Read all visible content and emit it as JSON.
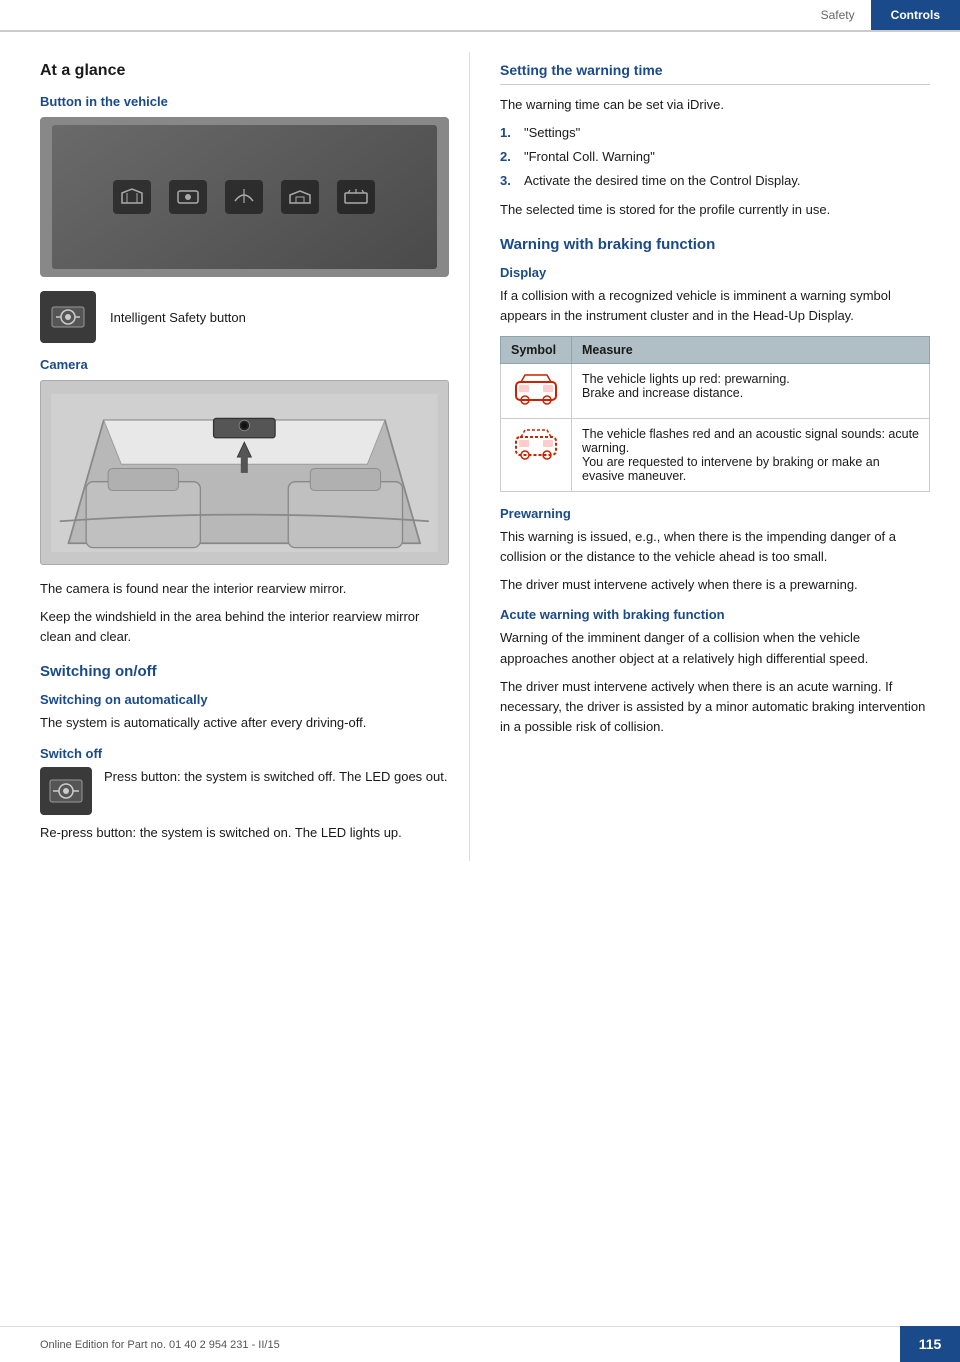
{
  "header": {
    "safety_label": "Safety",
    "controls_label": "Controls"
  },
  "left": {
    "at_a_glance": "At a glance",
    "button_in_vehicle": "Button in the vehicle",
    "intelligent_safety_label": "Intelligent Safety button",
    "camera_label": "Camera",
    "camera_desc1": "The camera is found near the interior rearview mirror.",
    "camera_desc2": "Keep the windshield in the area behind the interior rearview mirror clean and clear.",
    "switching_onoff": "Switching on/off",
    "switching_automatically": "Switching on automatically",
    "switching_auto_desc": "The system is automatically active after every driving-off.",
    "switch_off": "Switch off",
    "switch_off_desc": "Press button: the system is switched off. The LED goes out.",
    "switch_off_desc2": "Re-press button: the system is switched on. The LED lights up."
  },
  "right": {
    "setting_warning_time": "Setting the warning time",
    "warning_time_desc": "The warning time can be set via iDrive.",
    "steps": [
      {
        "num": "1.",
        "text": "\"Settings\""
      },
      {
        "num": "2.",
        "text": "\"Frontal Coll. Warning\""
      },
      {
        "num": "3.",
        "text": "Activate the desired time on the Control Display."
      }
    ],
    "warning_time_note": "The selected time is stored for the profile currently in use.",
    "warning_braking_function": "Warning with braking function",
    "display_label": "Display",
    "display_desc": "If a collision with a recognized vehicle is imminent a warning symbol appears in the instrument cluster and in the Head-Up Display.",
    "table": {
      "col1": "Symbol",
      "col2": "Measure",
      "rows": [
        {
          "measure": "The vehicle lights up red: prewarning.\nBrake and increase distance."
        },
        {
          "measure": "The vehicle flashes red and an acoustic signal sounds: acute warning.\nYou are requested to intervene by braking or make an evasive maneuver."
        }
      ]
    },
    "prewarning_label": "Prewarning",
    "prewarning_desc1": "This warning is issued, e.g., when there is the impending danger of a collision or the distance to the vehicle ahead is too small.",
    "prewarning_desc2": "The driver must intervene actively when there is a prewarning.",
    "acute_warning_label": "Acute warning with braking function",
    "acute_warning_desc1": "Warning of the imminent danger of a collision when the vehicle approaches another object at a relatively high differential speed.",
    "acute_warning_desc2": "The driver must intervene actively when there is an acute warning. If necessary, the driver is assisted by a minor automatic braking intervention in a possible risk of collision."
  },
  "footer": {
    "text": "Online Edition for Part no. 01 40 2 954 231 - II/15",
    "page": "115"
  }
}
